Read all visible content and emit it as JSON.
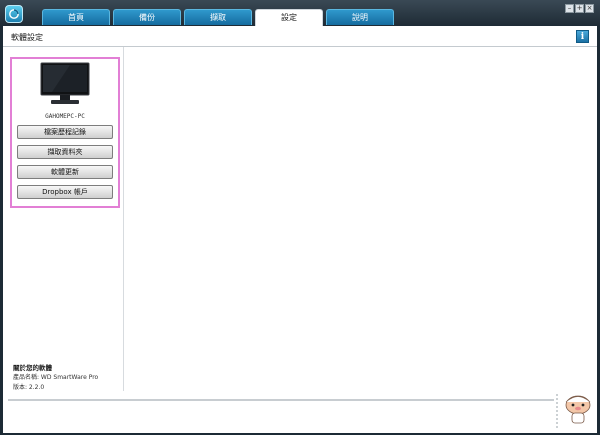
{
  "tabs": [
    {
      "label": "首頁"
    },
    {
      "label": "備份"
    },
    {
      "label": "擷取"
    },
    {
      "label": "設定"
    },
    {
      "label": "說明"
    }
  ],
  "page_title": "軟體設定",
  "info_icon": "i",
  "device": {
    "name": "GAHOMEPC-PC",
    "buttons": [
      {
        "label": "檔案歷程記錄"
      },
      {
        "label": "擷取資料夾"
      },
      {
        "label": "軟體更新"
      },
      {
        "label": "Dropbox 帳戶"
      }
    ]
  },
  "about": {
    "title": "關於您的軟體",
    "lines": [
      "產品名稱: WD SmartWare Pro",
      "版本: 2.2.0"
    ]
  },
  "colors": {
    "frame": "#1c2a35",
    "tab": "#1f82b8",
    "panel_highlight": "#e27fd5"
  }
}
